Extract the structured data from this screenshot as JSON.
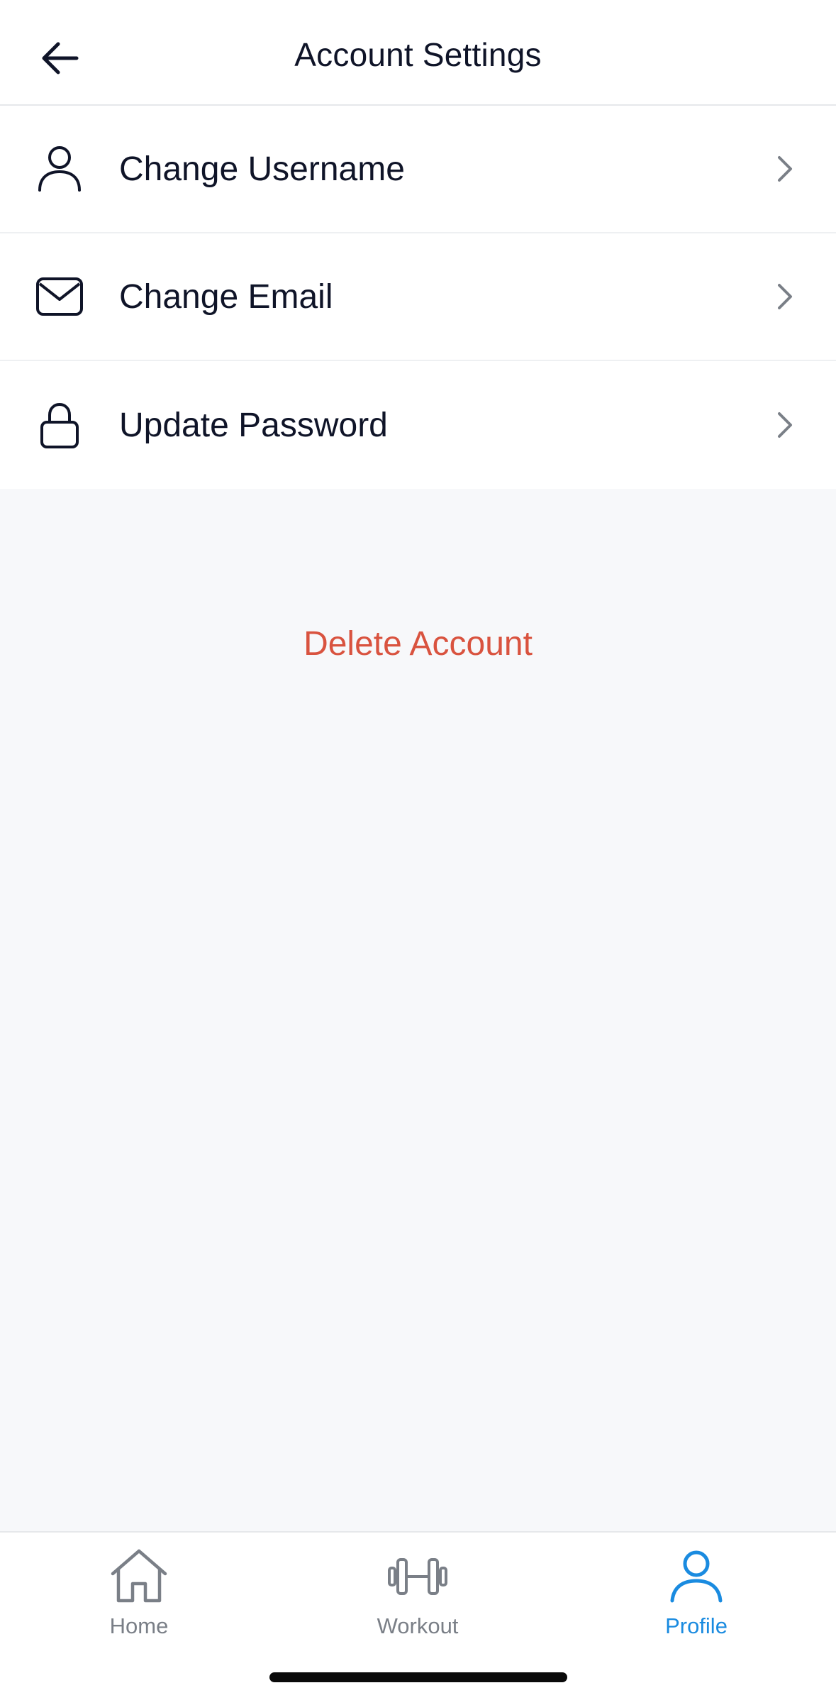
{
  "header": {
    "title": "Account Settings",
    "back_icon": "arrow-left-icon"
  },
  "menu": {
    "items": [
      {
        "label": "Change Username",
        "icon": "user-icon"
      },
      {
        "label": "Change Email",
        "icon": "mail-icon"
      },
      {
        "label": "Update Password",
        "icon": "lock-icon"
      }
    ]
  },
  "delete_label": "Delete Account",
  "tabs": [
    {
      "label": "Home",
      "icon": "home-icon",
      "active": false
    },
    {
      "label": "Workout",
      "icon": "dumbbell-icon",
      "active": false
    },
    {
      "label": "Profile",
      "icon": "profile-icon",
      "active": true
    }
  ],
  "colors": {
    "text": "#0f1428",
    "danger": "#d9533f",
    "accent": "#1a8be0",
    "inactive": "#7a7f87",
    "background": "#f7f8fa"
  }
}
